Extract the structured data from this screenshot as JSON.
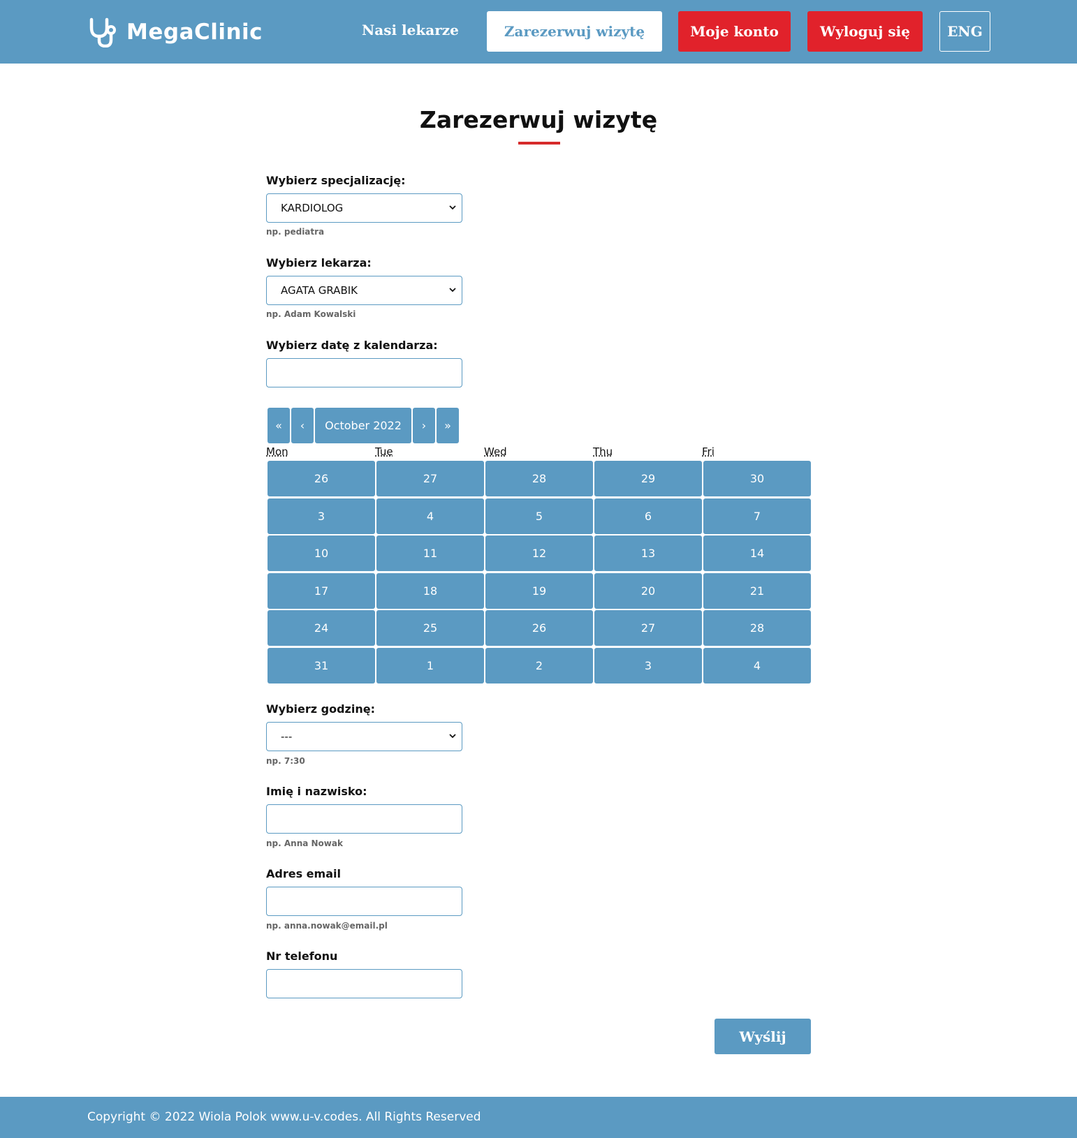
{
  "header": {
    "brand": "MegaClinic",
    "nav_doctors": "Nasi lekarze",
    "nav_book": "Zarezerwuj wizytę",
    "nav_account": "Moje konto",
    "nav_logout": "Wyloguj się",
    "nav_lang": "ENG",
    "logo_icon": "stethoscope-icon"
  },
  "page": {
    "title": "Zarezerwuj wizytę"
  },
  "form": {
    "specialization": {
      "label": "Wybierz specjalizację:",
      "value": "KARDIOLOG",
      "hint": "np. pediatra"
    },
    "doctor": {
      "label": "Wybierz lekarza:",
      "value": "AGATA GRABIK",
      "hint": "np. Adam Kowalski"
    },
    "date": {
      "label": "Wybierz datę z kalendarza:",
      "value": ""
    },
    "time": {
      "label": "Wybierz godzinę:",
      "value": "---",
      "hint": "np. 7:30"
    },
    "name": {
      "label": "Imię i nazwisko:",
      "value": "",
      "hint": "np. Anna Nowak"
    },
    "email": {
      "label": "Adres email",
      "value": "",
      "hint": "np. anna.nowak@email.pl"
    },
    "phone": {
      "label": "Nr telefonu",
      "value": ""
    },
    "submit_label": "Wyślij"
  },
  "calendar": {
    "prev_year": "«",
    "prev_month": "‹",
    "month_label": "October 2022",
    "next_month": "›",
    "next_year": "»",
    "weekdays": [
      "Mon",
      "Tue",
      "Wed",
      "Thu",
      "Fri"
    ],
    "weeks": [
      [
        "26",
        "27",
        "28",
        "29",
        "30"
      ],
      [
        "3",
        "4",
        "5",
        "6",
        "7"
      ],
      [
        "10",
        "11",
        "12",
        "13",
        "14"
      ],
      [
        "17",
        "18",
        "19",
        "20",
        "21"
      ],
      [
        "24",
        "25",
        "26",
        "27",
        "28"
      ],
      [
        "31",
        "1",
        "2",
        "3",
        "4"
      ]
    ]
  },
  "footer": {
    "copyright": "Copyright © 2022 Wiola Polok www.u-v.codes. All Rights Reserved"
  },
  "colors": {
    "primary": "#5b9ac2",
    "accent_red": "#e1222b"
  }
}
